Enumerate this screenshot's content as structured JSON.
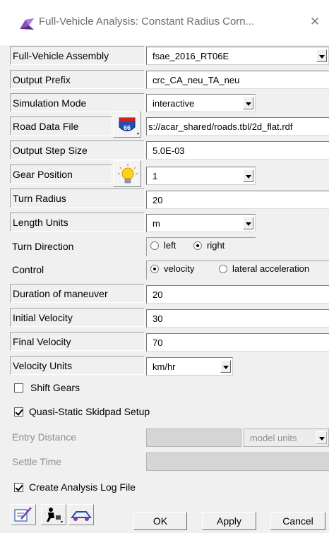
{
  "window": {
    "title": "Full-Vehicle Analysis: Constant Radius Corn...",
    "close_glyph": "✕"
  },
  "fields": {
    "assembly": {
      "label": "Full-Vehicle Assembly",
      "value": "fsae_2016_RT06E"
    },
    "output_prefix": {
      "label": "Output Prefix",
      "value": "crc_CA_neu_TA_neu"
    },
    "simulation_mode": {
      "label": "Simulation Mode",
      "value": "interactive"
    },
    "road_data_file": {
      "label": "Road Data File",
      "value": "s://acar_shared/roads.tbl/2d_flat.rdf",
      "icon_text": "66"
    },
    "output_step_size": {
      "label": "Output Step Size",
      "value": "5.0E-03"
    },
    "gear_position": {
      "label": "Gear Position",
      "value": "1"
    },
    "turn_radius": {
      "label": "Turn Radius",
      "value": "20"
    },
    "length_units": {
      "label": "Length Units",
      "value": "m"
    },
    "turn_direction": {
      "label": "Turn Direction",
      "options": [
        "left",
        "right"
      ],
      "selected": "right"
    },
    "control": {
      "label": "Control",
      "options": [
        "velocity",
        "lateral acceleration"
      ],
      "selected": "velocity"
    },
    "duration": {
      "label": "Duration of maneuver",
      "value": "20"
    },
    "initial_velocity": {
      "label": "Initial Velocity",
      "value": "30"
    },
    "final_velocity": {
      "label": "Final Velocity",
      "value": "70"
    },
    "velocity_units": {
      "label": "Velocity Units",
      "value": "km/hr"
    }
  },
  "checks": {
    "shift_gears": {
      "label": "Shift Gears",
      "checked": false
    },
    "quasi_static": {
      "label": "Quasi-Static Skidpad Setup",
      "checked": true
    },
    "create_log": {
      "label": "Create Analysis Log File",
      "checked": true
    }
  },
  "disabled": {
    "entry_distance": {
      "label": "Entry Distance",
      "units": "model units"
    },
    "settle_time": {
      "label": "Settle Time"
    }
  },
  "buttons": {
    "ok": "OK",
    "apply": "Apply",
    "cancel": "Cancel"
  },
  "colors": {
    "accent_purple": "#7b3fb0",
    "route_blue": "#1f4fb0",
    "route_red": "#d22020",
    "bulb_yellow": "#ffd21a"
  }
}
